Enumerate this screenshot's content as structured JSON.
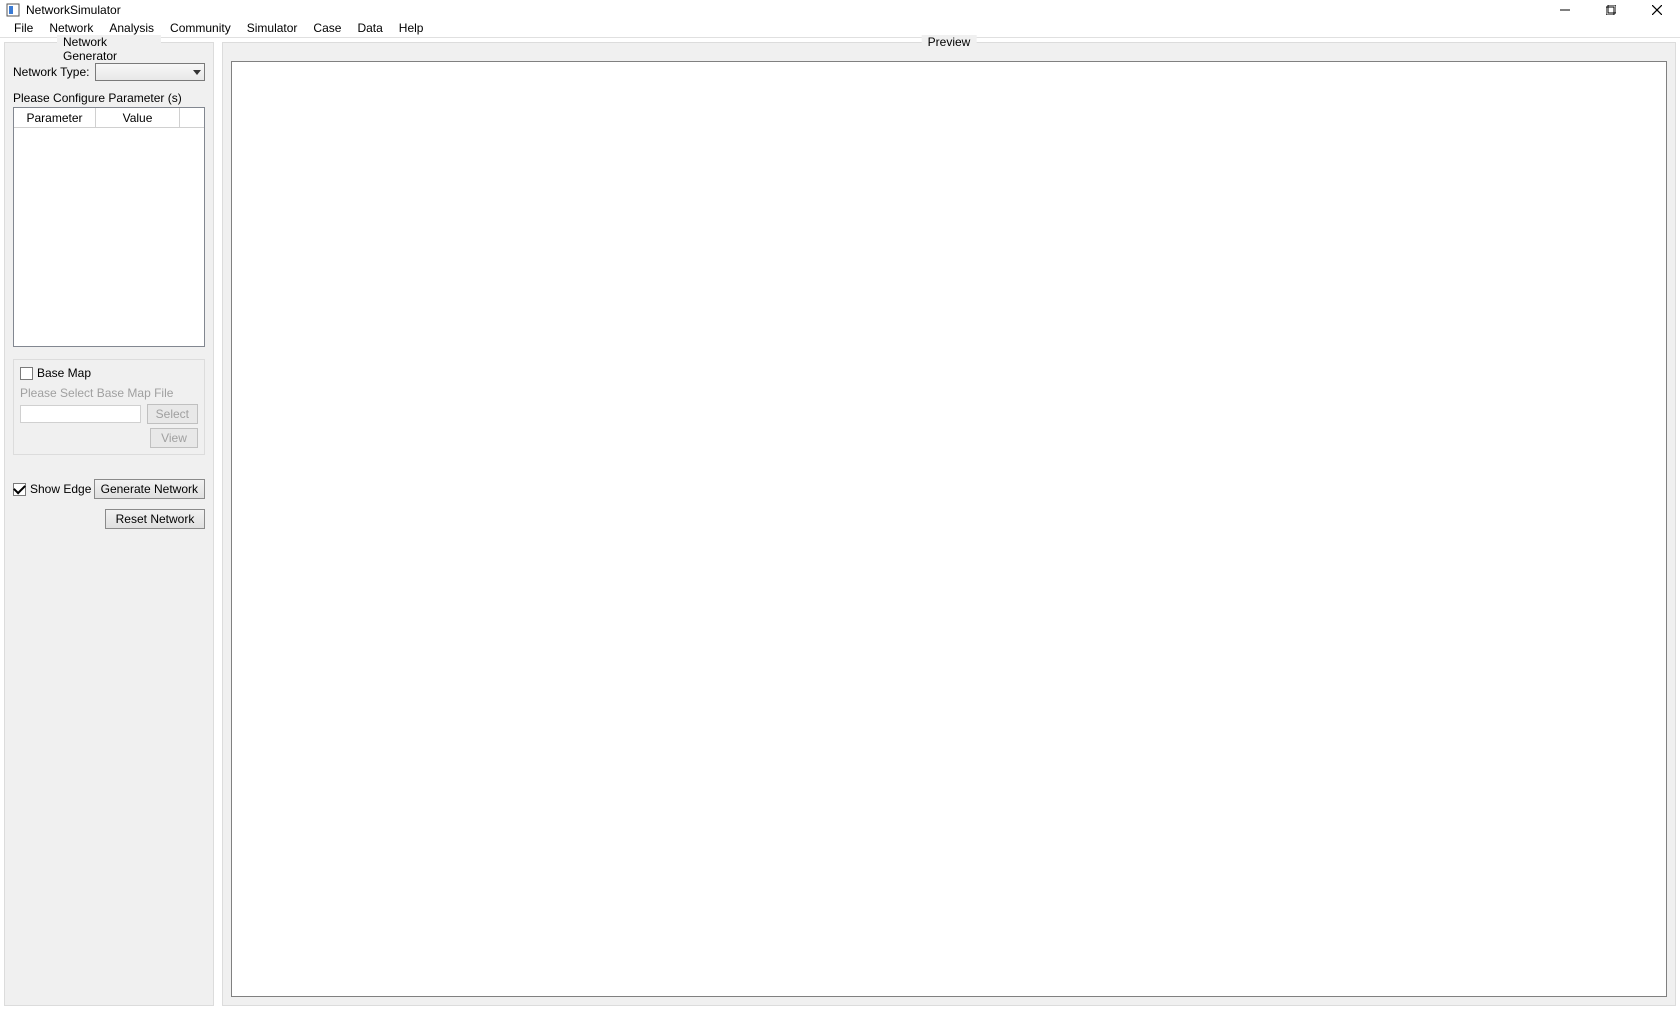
{
  "app": {
    "title": "NetworkSimulator"
  },
  "menu": {
    "items": [
      "File",
      "Network",
      "Analysis",
      "Community",
      "Simulator",
      "Case",
      "Data",
      "Help"
    ]
  },
  "left_panel": {
    "group_title": "Network Generator",
    "network_type_label": "Network Type:",
    "network_type_value": "",
    "configure_label": "Please Configure Parameter (s)",
    "param_table": {
      "columns": [
        "Parameter",
        "Value"
      ],
      "rows": []
    },
    "base_map": {
      "checkbox_label": "Base Map",
      "checked": false,
      "hint": "Please Select Base Map File",
      "file_value": "",
      "select_button": "Select",
      "view_button": "View"
    },
    "show_edge": {
      "label": "Show Edge",
      "checked": true
    },
    "generate_button": "Generate Network",
    "reset_button": "Reset Network"
  },
  "right_panel": {
    "group_title": "Preview"
  }
}
